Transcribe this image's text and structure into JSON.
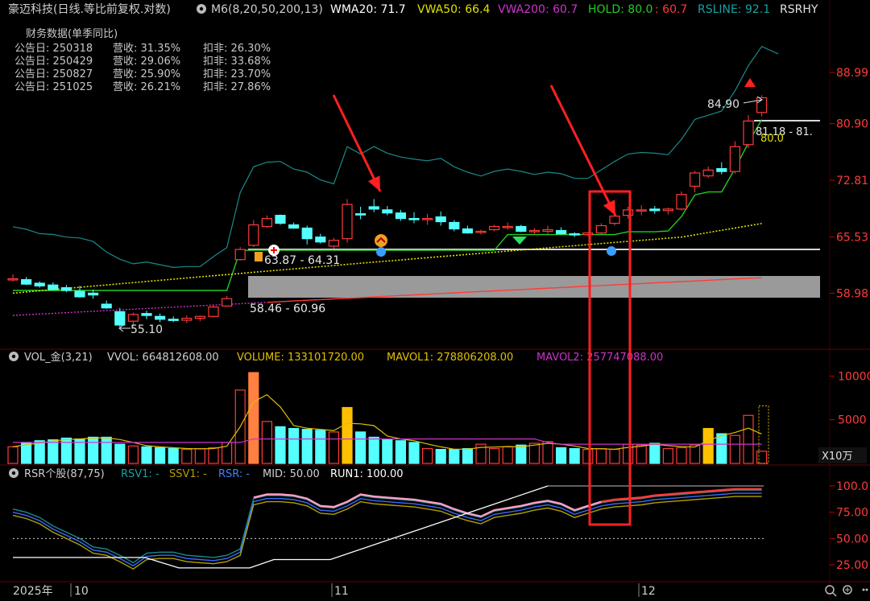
{
  "header": {
    "title": "豪迈科技(日线.等比前复权.对数)",
    "ma_label": "M6(8,20,50,200,13)",
    "wma20": "WMA20: 71.7",
    "vwa50": "VWA50: 66.4",
    "vwa200": "VWA200: 60.7",
    "hold": "HOLD: 80.0",
    "hold2": ": 60.7",
    "rsline": "RSLINE: 92.1",
    "rsrhy": "RSRHY"
  },
  "finance": {
    "title": "财务数据(单季同比)",
    "rows": [
      {
        "date": "公告日: 250318",
        "rev": "营收:  31.35%",
        "ded": "扣非:  26.30%"
      },
      {
        "date": "公告日: 250429",
        "rev": "营收:  29.06%",
        "ded": "扣非:  33.68%"
      },
      {
        "date": "公告日: 250827",
        "rev": "营收:  25.90%",
        "ded": "扣非:  23.70%"
      },
      {
        "date": "公告日: 251025",
        "rev": "营收:  26.21%",
        "ded": "扣非:  27.86%"
      }
    ]
  },
  "price_axis": [
    "88.99",
    "80.90",
    "72.81",
    "65.53",
    "58.98"
  ],
  "annotations": {
    "high": "84.90",
    "low": "55.10",
    "zone1": "63.87 - 64.31",
    "zone2": "58.46 - 60.96",
    "right_zone": "81.18 - 81.",
    "hold_val": "80.0"
  },
  "volume_panel": {
    "title": "VOL_金(3,21)",
    "vvol": "VVOL: 664812608.00",
    "volume": "VOLUME: 133101720.00",
    "mavol1": "MAVOL1: 278806208.00",
    "mavol2": "MAVOL2: 257747088.00",
    "axis": [
      "10000",
      "5000"
    ],
    "unit": "X10万"
  },
  "rsr_panel": {
    "title": "RSR个股(87,75)",
    "rsv1": "RSV1: -",
    "ssv1": "SSV1: -",
    "rsr": "RSR: -",
    "mid": "MID: 50.00",
    "run1": "RUN1: 100.00",
    "axis": [
      "100.0",
      "75.00",
      "50.00",
      "25.00"
    ]
  },
  "time_axis": {
    "year": "2025年",
    "labels": [
      "10",
      "11",
      "12"
    ]
  },
  "colors": {
    "up": "#ff3b3b",
    "down": "#54ffff",
    "wma": "#ffffff",
    "vwa50": "#e0e000",
    "vwa200": "#cc33cc",
    "hold": "#22cc22",
    "rsline": "#1a8a8a",
    "volbar_gold": "#ffc000",
    "volbar_orange": "#ff8040"
  },
  "chart_data": {
    "type": "candlestick",
    "candles": [
      {
        "o": 60.6,
        "h": 61.1,
        "l": 60.3,
        "c": 60.6
      },
      {
        "o": 60.5,
        "h": 60.8,
        "l": 59.9,
        "c": 60.0
      },
      {
        "o": 60.1,
        "h": 60.3,
        "l": 59.6,
        "c": 59.8
      },
      {
        "o": 59.9,
        "h": 60.2,
        "l": 59.3,
        "c": 59.4
      },
      {
        "o": 59.6,
        "h": 59.9,
        "l": 59.1,
        "c": 59.3
      },
      {
        "o": 59.2,
        "h": 59.8,
        "l": 58.5,
        "c": 58.6
      },
      {
        "o": 59.0,
        "h": 59.4,
        "l": 58.4,
        "c": 58.8
      },
      {
        "o": 57.8,
        "h": 58.2,
        "l": 57.3,
        "c": 57.4
      },
      {
        "o": 57.0,
        "h": 57.4,
        "l": 55.4,
        "c": 55.6
      },
      {
        "o": 56.0,
        "h": 56.9,
        "l": 55.4,
        "c": 56.7
      },
      {
        "o": 56.8,
        "h": 57.1,
        "l": 56.2,
        "c": 56.6
      },
      {
        "o": 56.5,
        "h": 56.8,
        "l": 55.9,
        "c": 56.2
      },
      {
        "o": 56.2,
        "h": 56.5,
        "l": 55.9,
        "c": 56.1
      },
      {
        "o": 56.1,
        "h": 56.6,
        "l": 55.8,
        "c": 56.3
      },
      {
        "o": 56.3,
        "h": 56.6,
        "l": 56.0,
        "c": 56.5
      },
      {
        "o": 56.5,
        "h": 57.7,
        "l": 56.4,
        "c": 57.5
      },
      {
        "o": 57.6,
        "h": 58.7,
        "l": 57.6,
        "c": 58.4
      },
      {
        "o": 62.8,
        "h": 64.3,
        "l": 62.7,
        "c": 64.0
      },
      {
        "o": 64.5,
        "h": 67.6,
        "l": 64.3,
        "c": 67.0
      },
      {
        "o": 66.8,
        "h": 68.2,
        "l": 66.6,
        "c": 67.8
      },
      {
        "o": 68.2,
        "h": 68.3,
        "l": 67.0,
        "c": 67.2
      },
      {
        "o": 67.0,
        "h": 67.3,
        "l": 66.5,
        "c": 66.6
      },
      {
        "o": 66.6,
        "h": 66.9,
        "l": 64.6,
        "c": 65.3
      },
      {
        "o": 65.5,
        "h": 65.9,
        "l": 64.7,
        "c": 64.9
      },
      {
        "o": 64.4,
        "h": 65.4,
        "l": 64.1,
        "c": 65.1
      },
      {
        "o": 65.3,
        "h": 70.3,
        "l": 64.8,
        "c": 69.6
      },
      {
        "o": 68.4,
        "h": 69.3,
        "l": 67.7,
        "c": 68.3
      },
      {
        "o": 69.3,
        "h": 70.3,
        "l": 68.6,
        "c": 69.0
      },
      {
        "o": 68.9,
        "h": 69.4,
        "l": 68.2,
        "c": 68.5
      },
      {
        "o": 68.5,
        "h": 68.9,
        "l": 67.5,
        "c": 67.8
      },
      {
        "o": 67.8,
        "h": 68.6,
        "l": 67.2,
        "c": 67.7
      },
      {
        "o": 67.7,
        "h": 68.4,
        "l": 67.0,
        "c": 67.8
      },
      {
        "o": 68.0,
        "h": 68.7,
        "l": 66.9,
        "c": 67.4
      },
      {
        "o": 67.3,
        "h": 67.6,
        "l": 66.2,
        "c": 66.5
      },
      {
        "o": 66.5,
        "h": 66.9,
        "l": 65.9,
        "c": 66.0
      },
      {
        "o": 66.1,
        "h": 66.4,
        "l": 65.8,
        "c": 66.2
      },
      {
        "o": 66.4,
        "h": 67.0,
        "l": 66.2,
        "c": 66.8
      },
      {
        "o": 66.8,
        "h": 67.3,
        "l": 66.4,
        "c": 66.8
      },
      {
        "o": 66.8,
        "h": 67.0,
        "l": 66.1,
        "c": 66.2
      },
      {
        "o": 66.2,
        "h": 66.6,
        "l": 65.9,
        "c": 66.3
      },
      {
        "o": 66.2,
        "h": 66.9,
        "l": 65.9,
        "c": 66.4
      },
      {
        "o": 66.3,
        "h": 66.7,
        "l": 65.8,
        "c": 65.9
      },
      {
        "o": 65.9,
        "h": 66.1,
        "l": 65.5,
        "c": 65.8
      },
      {
        "o": 65.8,
        "h": 66.1,
        "l": 65.6,
        "c": 66.0
      },
      {
        "o": 66.0,
        "h": 67.2,
        "l": 65.8,
        "c": 66.9
      },
      {
        "o": 67.2,
        "h": 68.3,
        "l": 66.9,
        "c": 68.1
      },
      {
        "o": 68.2,
        "h": 69.3,
        "l": 67.8,
        "c": 68.9
      },
      {
        "o": 68.9,
        "h": 69.5,
        "l": 68.2,
        "c": 68.9
      },
      {
        "o": 69.0,
        "h": 69.4,
        "l": 68.4,
        "c": 68.8
      },
      {
        "o": 68.8,
        "h": 69.2,
        "l": 68.3,
        "c": 69.0
      },
      {
        "o": 69.0,
        "h": 71.3,
        "l": 68.8,
        "c": 70.9
      },
      {
        "o": 72.0,
        "h": 74.1,
        "l": 71.2,
        "c": 73.8
      },
      {
        "o": 73.4,
        "h": 74.7,
        "l": 73.1,
        "c": 74.2
      },
      {
        "o": 74.4,
        "h": 75.3,
        "l": 73.6,
        "c": 74.0
      },
      {
        "o": 74.0,
        "h": 78.3,
        "l": 73.7,
        "c": 77.5
      },
      {
        "o": 77.8,
        "h": 82.2,
        "l": 77.3,
        "c": 81.3
      },
      {
        "o": 82.6,
        "h": 85.3,
        "l": 82.0,
        "c": 84.9
      }
    ]
  }
}
